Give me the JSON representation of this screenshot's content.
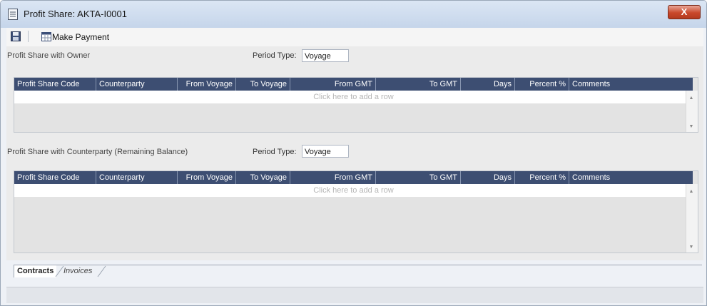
{
  "window": {
    "title": "Profit Share: AKTA-I0001",
    "close_glyph": "X"
  },
  "toolbar": {
    "save_icon": "save-icon",
    "make_payment_label": "Make Payment"
  },
  "owner_section": {
    "title": "Profit Share with Owner",
    "period_type_label": "Period Type:",
    "period_type_value": "Voyage"
  },
  "counterparty_section": {
    "title": "Profit Share with Counterparty (Remaining Balance)",
    "period_type_label": "Period Type:",
    "period_type_value": "Voyage"
  },
  "grid": {
    "columns": [
      "Profit Share Code",
      "Counterparty",
      "From Voyage",
      "To Voyage",
      "From GMT",
      "To GMT",
      "Days",
      "Percent %",
      "Comments"
    ],
    "add_row_text": "Click here to add a row"
  },
  "tabs": [
    "Contracts",
    "Invoices"
  ]
}
